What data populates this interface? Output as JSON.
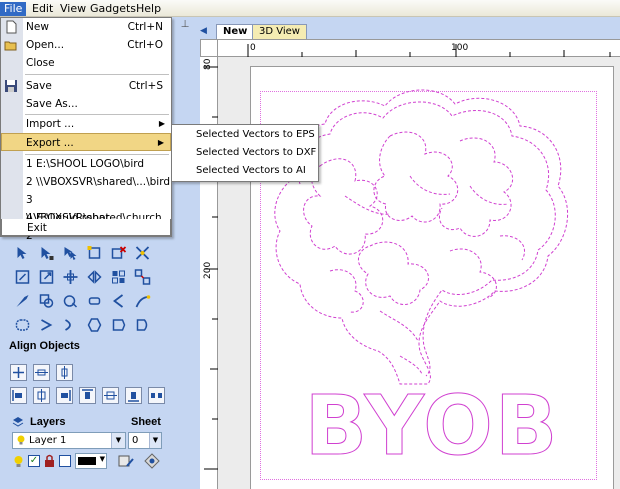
{
  "menubar": {
    "items": [
      {
        "label": "File"
      },
      {
        "label": "Edit"
      },
      {
        "label": "View"
      },
      {
        "label": "Gadgets"
      },
      {
        "label": "Help"
      }
    ]
  },
  "file_menu": {
    "new": {
      "label": "New",
      "shortcut": "Ctrl+N"
    },
    "open": {
      "label": "Open...",
      "shortcut": "Ctrl+O"
    },
    "close": {
      "label": "Close"
    },
    "save": {
      "label": "Save",
      "shortcut": "Ctrl+S"
    },
    "save_as": {
      "label": "Save As..."
    },
    "import": {
      "label": "Import ..."
    },
    "export": {
      "label": "Export ..."
    },
    "recent": [
      "1 E:\\SHOOL LOGO\\bird",
      "2 \\\\VBOXSVR\\shared\\...\\bird",
      "3 \\\\VBOXSVR\\shared\\church 2",
      "4 E:\\liquid robot"
    ],
    "exit": {
      "label": "Exit"
    }
  },
  "export_submenu": [
    "Selected Vectors to EPS",
    "Selected Vectors to DXF",
    "Selected Vectors to AI"
  ],
  "panel": {
    "align_title": "Align Objects",
    "layers_title": "Layers",
    "sheet_title": "Sheet",
    "layer_value": "Layer 1",
    "sheet_value": "0"
  },
  "tabs": [
    "New",
    "3D View"
  ],
  "ruler": {
    "h_labels": [
      "0",
      "100"
    ],
    "v_labels": [
      "80",
      "200"
    ]
  },
  "artwork": {
    "text": "BYOB",
    "stroke_color": "#d040d0"
  },
  "colors": {
    "panel_bg": "#c5d6f2",
    "menu_highlight": "#f1d685",
    "accent_magenta": "#d040d0"
  }
}
